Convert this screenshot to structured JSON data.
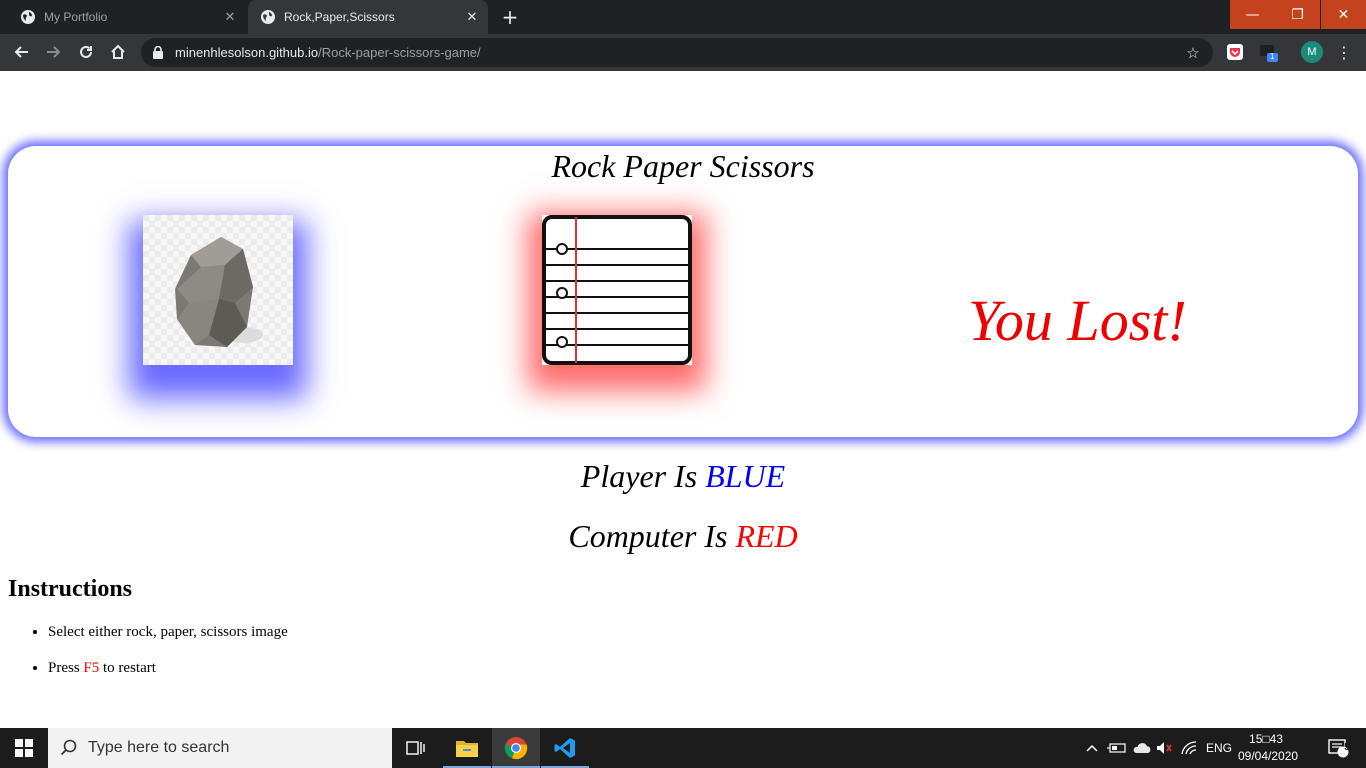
{
  "browser": {
    "tabs": [
      {
        "title": "My Portfolio",
        "close": "✕"
      },
      {
        "title": "Rock,Paper,Scissors",
        "close": "✕"
      }
    ],
    "new_tab": "+",
    "window_controls": {
      "minimize": "—",
      "maximize": "❐",
      "close": "✕"
    },
    "url": {
      "host": "minenhlesolson.github.io",
      "path": "/Rock-paper-scissors-game/"
    },
    "bookmark_icon": "☆",
    "extensions": {
      "badge": "1"
    },
    "profile_initial": "M",
    "menu": "⋮"
  },
  "game": {
    "title": "Rock Paper Scissors",
    "player_choice": "rock",
    "computer_choice": "paper",
    "result": "You Lost!",
    "player_prefix": "Player Is ",
    "player_color_label": "BLUE",
    "computer_prefix": "Computer Is ",
    "computer_color_label": "RED",
    "colors": {
      "player": "#0000ff",
      "computer": "#ff0000",
      "result": "#ef0000"
    }
  },
  "instructions": {
    "heading": "Instructions",
    "items": [
      {
        "text": "Select either rock, paper, scissors image"
      },
      {
        "before": "Press ",
        "key": "F5",
        "after": " to restart"
      }
    ]
  },
  "taskbar": {
    "search_placeholder": "Type here to search",
    "tray_language": "ENG",
    "time": "15□43",
    "date": "09/04/2020",
    "notifications_count": "5"
  }
}
